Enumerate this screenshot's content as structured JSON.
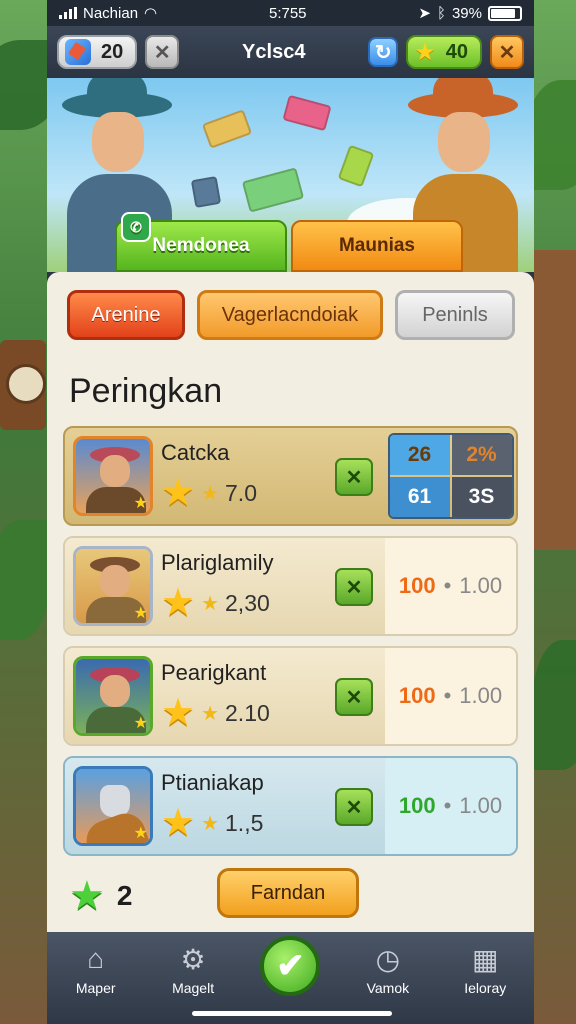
{
  "status": {
    "carrier": "Nachian",
    "time": "5:755",
    "battery": "39%"
  },
  "topbar": {
    "gems": "20",
    "title": "Yclsc4",
    "stars": "40"
  },
  "hero": {
    "tabs": [
      "Nemdonea",
      "Maunias"
    ]
  },
  "filters": [
    "Arenine",
    "Vagerlacndoiak",
    "Peninls"
  ],
  "heading": "Peringkan",
  "rows": [
    {
      "name": "Catcka",
      "score": "7.0",
      "grid": [
        "26",
        "2%",
        "61",
        "3S"
      ]
    },
    {
      "name": "Plariglamily",
      "score": "2,30",
      "value": "100",
      "sep": "•",
      "rate": "1.00"
    },
    {
      "name": "Pearigkant",
      "score": "2.10",
      "value": "100",
      "sep": "•",
      "rate": "1.00"
    },
    {
      "name": "Ptianiakap",
      "score": "1.,5",
      "value": "100",
      "sep": "•",
      "rate": "1.00"
    }
  ],
  "footer": {
    "count": "2",
    "action": "Farndan"
  },
  "nav": [
    "Maper",
    "Magelt",
    "Vamok",
    "Ieloray"
  ],
  "colors": {
    "accent_green": "#56b51e",
    "accent_orange": "#f28a12",
    "panel": "#f3eee2"
  }
}
